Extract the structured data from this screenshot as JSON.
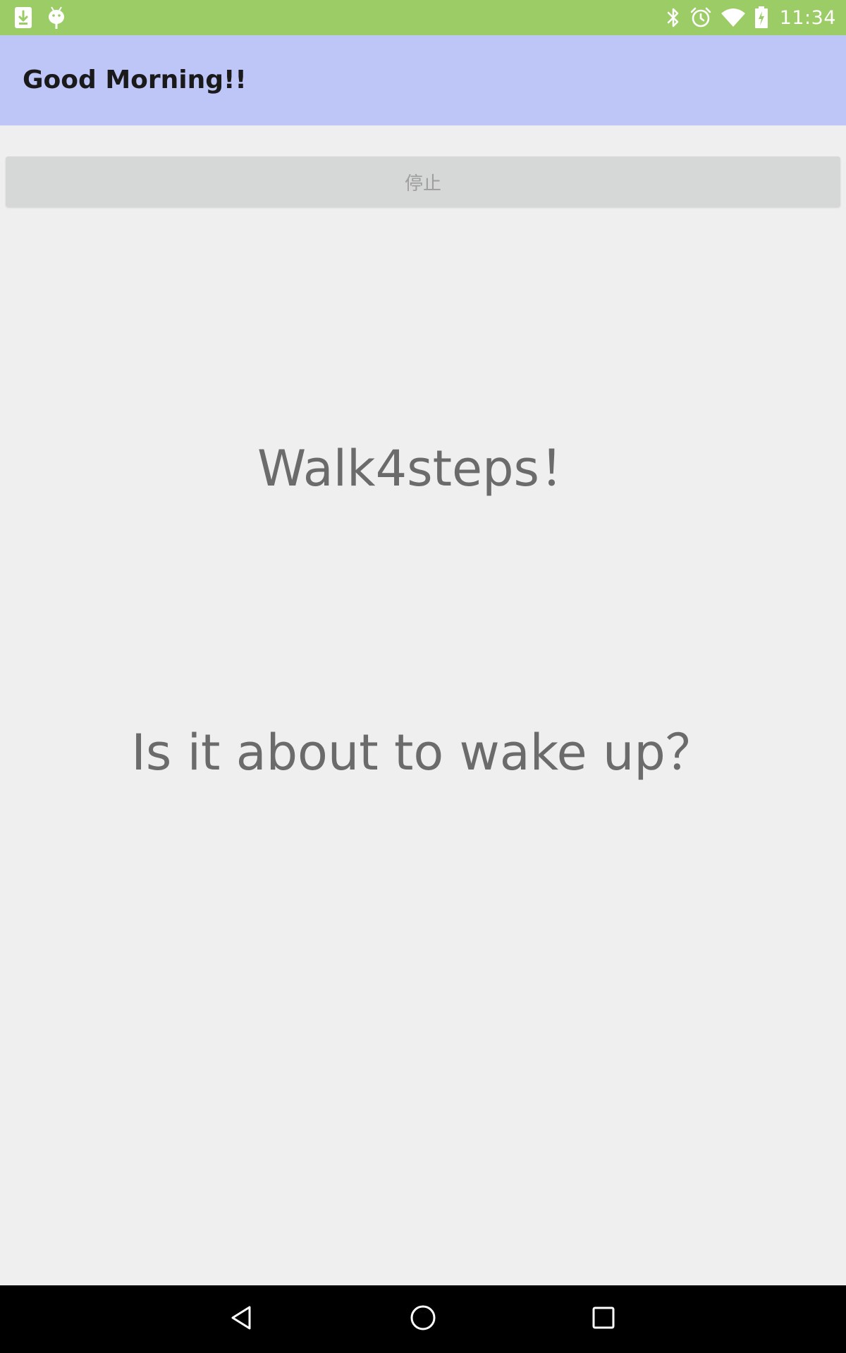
{
  "status_bar": {
    "time": "11:34",
    "left_icons": [
      "download-icon",
      "android-debug-icon"
    ],
    "right_icons": [
      "bluetooth-icon",
      "alarm-icon",
      "wifi-icon",
      "battery-icon"
    ],
    "background_color": "#9CCC65"
  },
  "app_bar": {
    "title": "Good Morning!!",
    "background_color": "#BEC6F8"
  },
  "main": {
    "stop_button_label": "停止",
    "walk_message": "Walk4steps！",
    "wake_message": "Is it about to wake up？"
  },
  "nav_bar": {
    "icons": [
      "back-icon",
      "home-icon",
      "recents-icon"
    ]
  }
}
